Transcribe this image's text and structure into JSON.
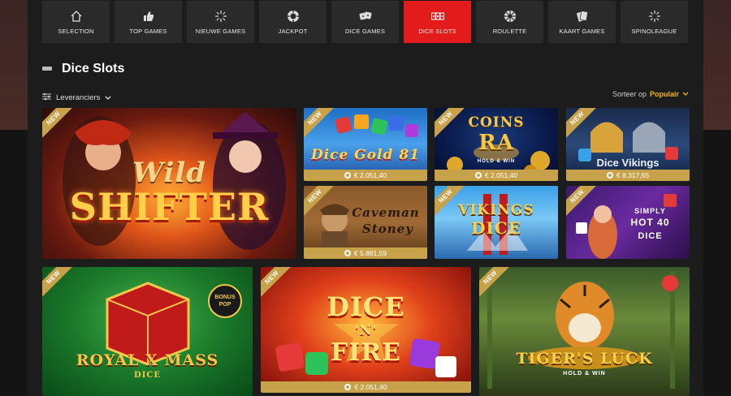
{
  "nav": {
    "items": [
      {
        "label": "SELECTION",
        "icon": "home-icon",
        "active": false
      },
      {
        "label": "TOP GAMES",
        "icon": "thumbs-up-icon",
        "active": false
      },
      {
        "label": "NIEUWE GAMES",
        "icon": "sparkle-icon",
        "active": false
      },
      {
        "label": "JACKPOT",
        "icon": "chip-icon",
        "active": false
      },
      {
        "label": "DICE GAMES",
        "icon": "dice-icon",
        "active": false
      },
      {
        "label": "DICE SLOTS",
        "icon": "slot-reels-icon",
        "active": true
      },
      {
        "label": "ROULETTE",
        "icon": "roulette-icon",
        "active": false
      },
      {
        "label": "KAART GAMES",
        "icon": "cards-icon",
        "active": false
      },
      {
        "label": "SPINOLEAGUE",
        "icon": "sparkle-icon",
        "active": false
      }
    ]
  },
  "section": {
    "title": "Dice Slots"
  },
  "filter": {
    "label": "Leveranciers"
  },
  "sort": {
    "label": "Sorteer op",
    "value": "Populair"
  },
  "games": [
    {
      "id": "wild-shifter",
      "title_line1": "Wild",
      "title_line2": "SHIFTER",
      "badge": "NEW",
      "jackpot": ""
    },
    {
      "id": "dice-gold-81",
      "title_line1": "Dice Gold 81",
      "badge": "NEW",
      "jackpot": "€ 2.051,40"
    },
    {
      "id": "coins-of-ra",
      "title_line1": "COINS",
      "title_line2": "RA",
      "subtitle": "HOLD & WIN",
      "badge": "NEW",
      "jackpot": "€ 2.051,40"
    },
    {
      "id": "dice-vikings",
      "title_line1": "Dice Vikings",
      "badge": "NEW",
      "jackpot": "€ 8.317,65"
    },
    {
      "id": "caveman-stoney",
      "title_line1": "Caveman",
      "title_line2": "Stoney",
      "badge": "NEW",
      "jackpot": "€ 5.881,59"
    },
    {
      "id": "vikings-dice",
      "title_line1": "VIKINGS",
      "title_line2": "DICE",
      "badge": "NEW",
      "jackpot": ""
    },
    {
      "id": "simply-hot-40-dice",
      "title_line1": "SIMPLY",
      "title_line2": "HOT 40",
      "title_line3": "DICE",
      "badge": "NEW",
      "jackpot": ""
    },
    {
      "id": "royal-xmass-dice",
      "title_line1": "ROYAL X MASS",
      "title_line2": "DICE",
      "corner": "BONUS POP",
      "badge": "NEW",
      "jackpot": ""
    },
    {
      "id": "dice-n-fire",
      "title_line1": "DICE",
      "title_line2": "'N'",
      "title_line3": "FIRE",
      "badge": "NEW",
      "jackpot": "€ 2.051,40"
    },
    {
      "id": "tigers-luck",
      "title_line1": "TIGER'S LUCK",
      "subtitle": "HOLD & WIN",
      "badge": "NEW",
      "jackpot": ""
    }
  ],
  "colors": {
    "accent": "#e31b1b",
    "gold": "#c8a24a",
    "sort_accent": "#f5b400"
  }
}
